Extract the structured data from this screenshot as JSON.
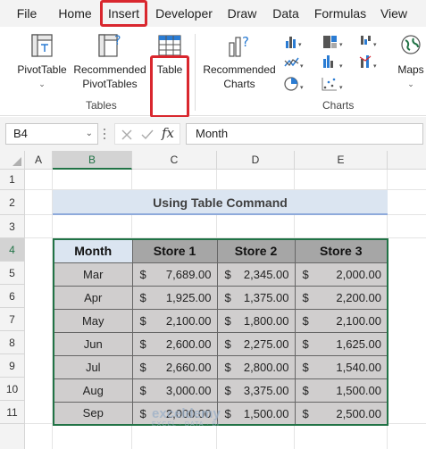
{
  "menu": {
    "items": [
      "File",
      "Home",
      "Insert",
      "Developer",
      "Draw",
      "Data",
      "Formulas",
      "View"
    ],
    "active": "Insert"
  },
  "ribbon": {
    "tables_group": {
      "label": "Tables",
      "pivottable": "PivotTable",
      "recommended_pivot_1": "Recommended",
      "recommended_pivot_2": "PivotTables",
      "table": "Table"
    },
    "charts_group": {
      "label": "Charts",
      "recommended_charts_1": "Recommended",
      "recommended_charts_2": "Charts",
      "maps": "Maps"
    }
  },
  "formula_bar": {
    "name_box": "B4",
    "fx": "fx",
    "content": "Month"
  },
  "grid": {
    "columns": [
      "A",
      "B",
      "C",
      "D",
      "E"
    ],
    "rows": [
      "1",
      "2",
      "3",
      "4",
      "5",
      "6",
      "7",
      "8",
      "9",
      "10",
      "11"
    ],
    "title": "Using Table Command"
  },
  "table": {
    "headers": [
      "Month",
      "Store 1",
      "Store 2",
      "Store 3"
    ],
    "currency": "$",
    "rows": [
      [
        "Mar",
        "7,689.00",
        "2,345.00",
        "2,000.00"
      ],
      [
        "Apr",
        "1,925.00",
        "1,375.00",
        "2,200.00"
      ],
      [
        "May",
        "2,100.00",
        "1,800.00",
        "2,100.00"
      ],
      [
        "Jun",
        "2,600.00",
        "2,275.00",
        "1,625.00"
      ],
      [
        "Jul",
        "2,660.00",
        "2,800.00",
        "1,540.00"
      ],
      [
        "Aug",
        "3,000.00",
        "3,375.00",
        "1,500.00"
      ],
      [
        "Sep",
        "2,000.00",
        "1,500.00",
        "2,500.00"
      ]
    ]
  },
  "watermark": {
    "name": "exceldemy",
    "tagline": "EXCEL · DATA · BI"
  }
}
